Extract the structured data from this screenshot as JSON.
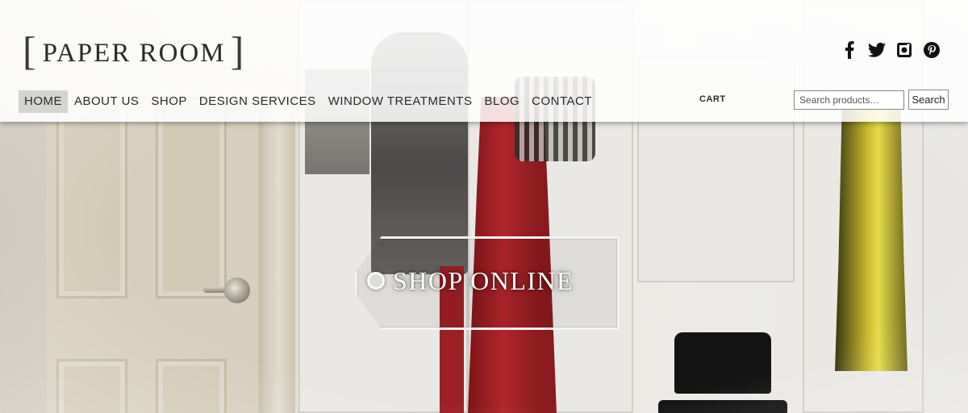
{
  "brand": {
    "logo_text": "PAPER ROOM"
  },
  "social": [
    {
      "icon": "facebook-icon"
    },
    {
      "icon": "twitter-icon"
    },
    {
      "icon": "instagram-icon"
    },
    {
      "icon": "pinterest-icon"
    }
  ],
  "nav": {
    "items": [
      {
        "label": "HOME",
        "active": true
      },
      {
        "label": "ABOUT US"
      },
      {
        "label": "SHOP"
      },
      {
        "label": "DESIGN SERVICES"
      },
      {
        "label": "WINDOW TREATMENTS"
      },
      {
        "label": "BLOG"
      },
      {
        "label": "CONTACT"
      }
    ]
  },
  "cart": {
    "label": "CART"
  },
  "search": {
    "placeholder": "Search products…",
    "button_label": "Search"
  },
  "hero": {
    "cta_label": "SHOP ONLINE"
  },
  "colors": {
    "header_bg": "#ffffff",
    "active_nav_bg": "#d4d4d2",
    "text": "#2a2a2a"
  }
}
